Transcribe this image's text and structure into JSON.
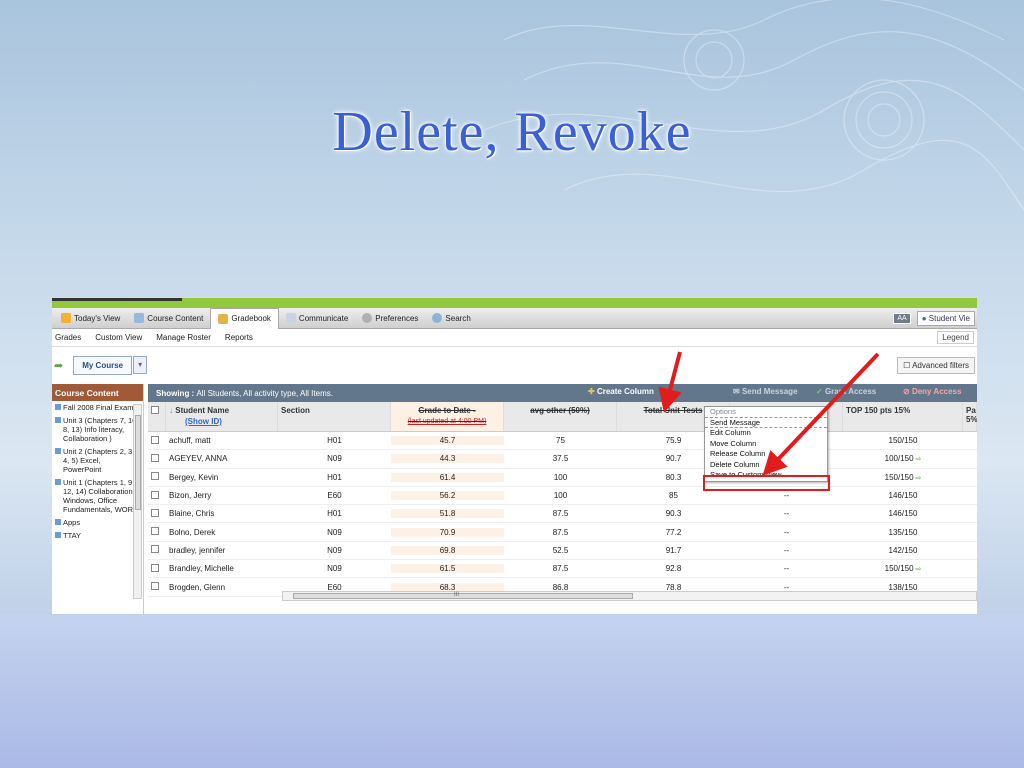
{
  "slide": {
    "title": "Delete, Revoke"
  },
  "nav": {
    "items": [
      "Today's View",
      "Course Content",
      "Gradebook",
      "Communicate",
      "Preferences",
      "Search"
    ],
    "active_index": 2,
    "aa_label": "AA",
    "student_view": "Student Vie"
  },
  "subnav": {
    "items": [
      "Grades",
      "Custom View",
      "Manage Roster",
      "Reports"
    ],
    "legend": "Legend"
  },
  "toolbar": {
    "my_course": "My Course",
    "advanced_filters": "Advanced filters"
  },
  "sidebar": {
    "title": "Course Content",
    "items": [
      "Fall 2008 Final Exam",
      "Unit 3 (Chapters 7, 10, 8, 13) Info literacy, Collaboration )",
      "Unit 2 (Chapters 2, 3, 4, 5) Excel, PowerPoint",
      "Unit 1 (Chapters 1, 9, 12, 14) Collaboration, Windows, Office Fundamentals, WORD",
      "Apps",
      "TTAY"
    ]
  },
  "showbar": {
    "label": "Showing :",
    "value": "All Students, All activity type, All Items.",
    "create_column": "Create Column",
    "send_message": "Send Message",
    "grant_access": "Grant Access",
    "deny_access": "Deny Access"
  },
  "table": {
    "headers": {
      "student": "Student Name",
      "show_id": "(Show ID)",
      "section": "Section",
      "grade_to_date": "Grade to Date -",
      "last_updated": "(last updated at 4:00 PM)",
      "avg_other": "avg other (50%)",
      "total_unit_tests": "Total Unit Tests",
      "top150": "TOP 150 pts 15%",
      "partial": "Pa",
      "partial_pct": "5%"
    },
    "rows": [
      {
        "name": "achuff, matt",
        "section": "H01",
        "grade": "45.7",
        "avg": "75",
        "total": "75.9",
        "col6": "",
        "top": "150/150",
        "arrow": false
      },
      {
        "name": "AGEYEV, ANNA",
        "section": "N09",
        "grade": "44.3",
        "avg": "37.5",
        "total": "90.7",
        "col6": "",
        "top": "100/150",
        "arrow": true
      },
      {
        "name": "Bergey, Kevin",
        "section": "H01",
        "grade": "61.4",
        "avg": "100",
        "total": "80.3",
        "col6": "",
        "top": "150/150",
        "arrow": true
      },
      {
        "name": "Bizon, Jerry",
        "section": "E60",
        "grade": "56.2",
        "avg": "100",
        "total": "85",
        "col6": "--",
        "top": "146/150",
        "arrow": false
      },
      {
        "name": "Blaine, Chris",
        "section": "H01",
        "grade": "51.8",
        "avg": "87.5",
        "total": "90.3",
        "col6": "--",
        "top": "146/150",
        "arrow": false
      },
      {
        "name": "Bolno, Derek",
        "section": "N09",
        "grade": "70.9",
        "avg": "87.5",
        "total": "77.2",
        "col6": "--",
        "top": "135/150",
        "arrow": false
      },
      {
        "name": "bradley, jennifer",
        "section": "N09",
        "grade": "69.8",
        "avg": "52.5",
        "total": "91.7",
        "col6": "--",
        "top": "142/150",
        "arrow": false
      },
      {
        "name": "Brandley, Michelle",
        "section": "N09",
        "grade": "61.5",
        "avg": "87.5",
        "total": "92.8",
        "col6": "--",
        "top": "150/150",
        "arrow": true
      },
      {
        "name": "Brogden, Glenn",
        "section": "E60",
        "grade": "68.3",
        "avg": "86.8",
        "total": "78.8",
        "col6": "--",
        "top": "138/150",
        "arrow": false
      }
    ]
  },
  "options_menu": {
    "title": "Options",
    "items": [
      "Send Message",
      "Edit Column",
      "Move Column",
      "Release Column",
      "Delete Column",
      "Save to Custom View"
    ],
    "highlighted_index": 5
  },
  "scrollbar": {
    "grip": "III"
  },
  "colors": {
    "accent_green": "#92c83e",
    "sidebar_head": "#a05a37",
    "annotation_red": "#e21b1b",
    "title_blue": "#3b5fd4"
  }
}
